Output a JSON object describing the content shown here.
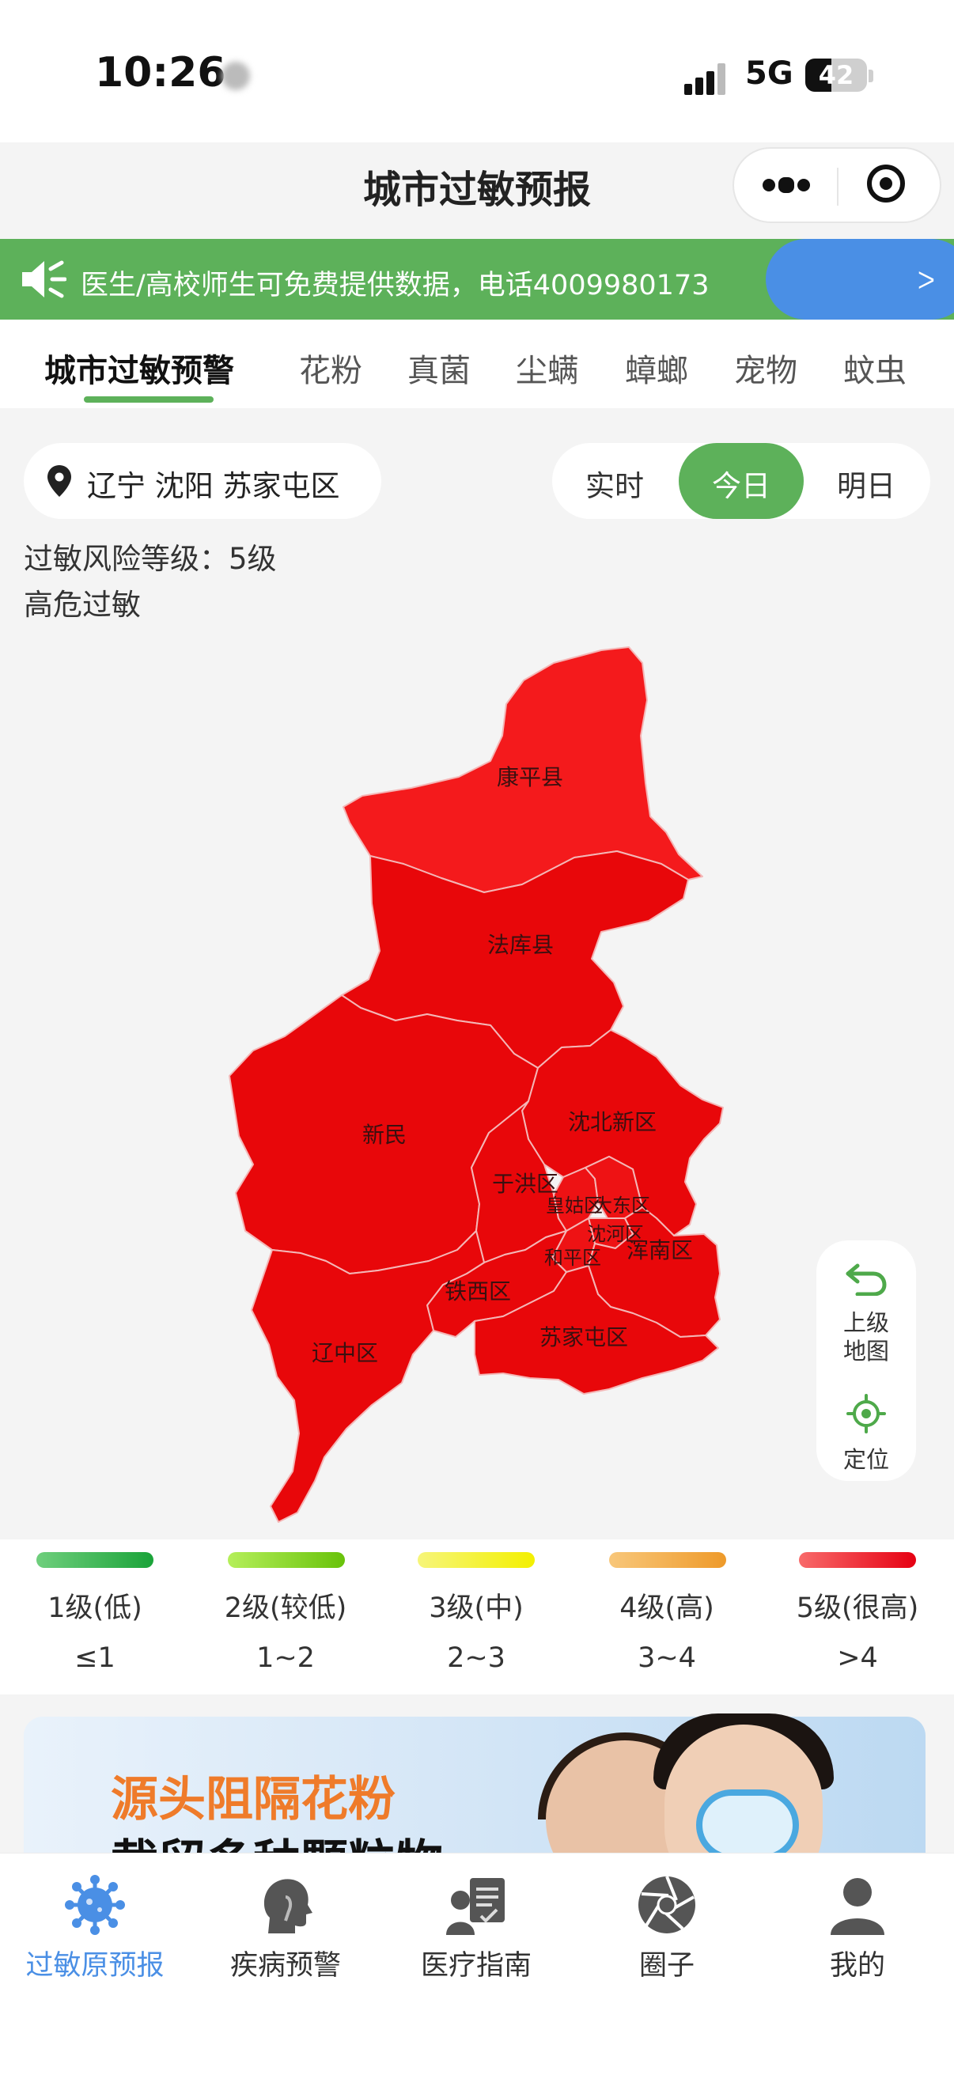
{
  "status_bar": {
    "time": "10:26",
    "network": "5G",
    "battery": "42",
    "battery_level": 0.42
  },
  "nav": {
    "title": "城市过敏预报"
  },
  "notice": {
    "text": "医生/高校师生可免费提供数据，电话4009980173",
    "button_glyph": "ᐳ"
  },
  "tabs": [
    "城市过敏预警",
    "花粉",
    "真菌",
    "尘螨",
    "蟑螂",
    "宠物",
    "蚊虫"
  ],
  "location": {
    "text": "辽宁 沈阳 苏家屯区"
  },
  "time_segments": [
    "实时",
    "今日",
    "明日"
  ],
  "selected_segment": "今日",
  "risk": {
    "level_text": "过敏风险等级：5级",
    "desc": "高危过敏"
  },
  "map": {
    "regions": [
      "康平县",
      "法库县",
      "新民",
      "沈北新区",
      "于洪区",
      "皇姑区",
      "大东区",
      "沈河区",
      "和平区",
      "浑南区",
      "铁西区",
      "辽中区",
      "苏家屯区"
    ],
    "fill_color": "#e8070a",
    "fill_color_light": "#f41a1c"
  },
  "side_buttons": {
    "up_label_1": "上级",
    "up_label_2": "地图",
    "locate_label": "定位"
  },
  "legend": [
    {
      "name": "1级(低)",
      "range": "≤1",
      "color_from": "#6fcf7d",
      "color_to": "#1aa339"
    },
    {
      "name": "2级(较低)",
      "range": "1~2",
      "color_from": "#b5ef5a",
      "color_to": "#68c20a"
    },
    {
      "name": "3级(中)",
      "range": "2~3",
      "color_from": "#f6f57a",
      "color_to": "#f3f000"
    },
    {
      "name": "4级(高)",
      "range": "3~4",
      "color_from": "#f8c77a",
      "color_to": "#ee9a2a"
    },
    {
      "name": "5级(很高)",
      "range": ">4",
      "color_from": "#f86a6a",
      "color_to": "#e60012"
    }
  ],
  "ad": {
    "line1": "源头阻隔花粉",
    "line2": "截留多种颗粒物"
  },
  "bottom_nav": [
    {
      "label": "过敏原预报",
      "icon": "virus-icon",
      "active": true
    },
    {
      "label": "疾病预警",
      "icon": "head-profile-icon",
      "active": false
    },
    {
      "label": "医疗指南",
      "icon": "doctor-report-icon",
      "active": false
    },
    {
      "label": "圈子",
      "icon": "aperture-icon",
      "active": false
    },
    {
      "label": "我的",
      "icon": "person-icon",
      "active": false
    }
  ]
}
